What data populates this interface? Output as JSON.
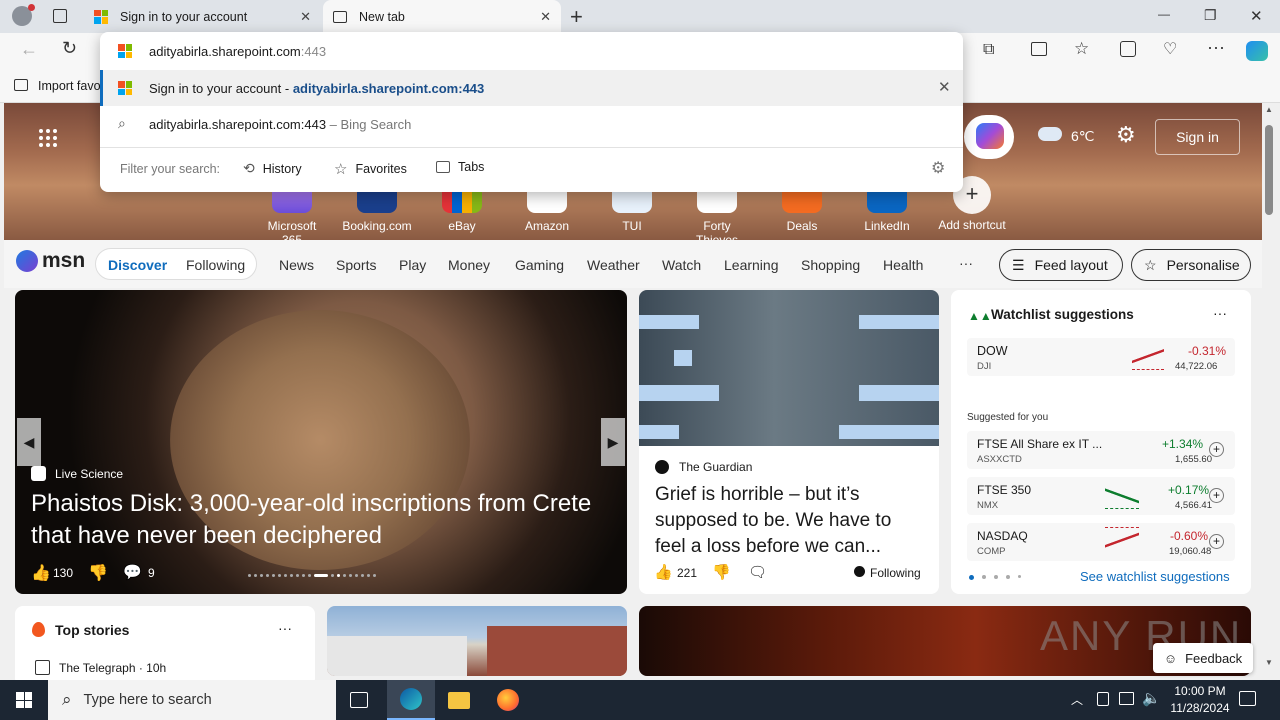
{
  "tabs": [
    {
      "title": "Sign in to your account",
      "active": false
    },
    {
      "title": "New tab",
      "active": true
    }
  ],
  "window_controls": {
    "minimize": "—",
    "restore": "❐",
    "close": "✕"
  },
  "bookmarks": {
    "import": "Import favo"
  },
  "omnibox": {
    "input_value": "adityabirla.sharepoint.com",
    "input_suffix": ":443",
    "suggestions": [
      {
        "title": "Sign in to your account",
        "sep": " - ",
        "url": "adityabirla.sharepoint.com:443"
      },
      {
        "query": "adityabirla.sharepoint.com:443",
        "hint": " – Bing Search"
      }
    ],
    "filter_label": "Filter your search:",
    "filters": [
      "History",
      "Favorites",
      "Tabs"
    ]
  },
  "hero": {
    "weather": "6℃",
    "signin": "Sign in",
    "shortcuts": [
      "Microsoft 365",
      "Booking.com",
      "eBay",
      "Amazon",
      "TUI",
      "Forty Thieves",
      "Deals",
      "LinkedIn",
      "Add shortcut"
    ]
  },
  "msn_nav": {
    "logo": "msn",
    "tabs": [
      "Discover",
      "Following"
    ],
    "links": [
      "News",
      "Sports",
      "Play",
      "Money",
      "Gaming",
      "Weather",
      "Watch",
      "Learning",
      "Shopping",
      "Health"
    ],
    "more": "···",
    "feed_layout": "Feed layout",
    "personalise": "Personalise"
  },
  "main_card": {
    "source": "Live Science",
    "headline": "Phaistos Disk: 3,000-year-old inscriptions from Crete that have never been deciphered",
    "likes": "130",
    "comments": "9"
  },
  "guardian_card": {
    "source": "The Guardian",
    "headline": "Grief is horrible – but it’s supposed to be. We have to feel a loss before we can...",
    "likes": "221",
    "following": "Following"
  },
  "watchlist": {
    "title": "Watchlist suggestions",
    "more": "···",
    "primary": {
      "name": "DOW",
      "sym": "DJI",
      "change": "-0.31%",
      "price": "44,722.06"
    },
    "suggested_label": "Suggested for you",
    "items": [
      {
        "name": "FTSE All Share ex IT ...",
        "sym": "ASXXCTD",
        "change": "+1.34%",
        "price": "1,655.60",
        "up": true
      },
      {
        "name": "FTSE 350",
        "sym": "NMX",
        "change": "+0.17%",
        "price": "4,566.41",
        "up": true
      },
      {
        "name": "NASDAQ",
        "sym": "COMP",
        "change": "-0.60%",
        "price": "19,060.48",
        "up": false
      }
    ],
    "see_more": "See watchlist suggestions"
  },
  "top_stories": {
    "title": "Top stories",
    "more": "···",
    "first_source": "The Telegraph · 10h"
  },
  "feedback": "Feedback",
  "watermark": "ANY RUN",
  "taskbar": {
    "search_placeholder": "Type here to search",
    "time": "10:00 PM",
    "date": "11/28/2024"
  },
  "colors": {
    "accent": "#0f6cbd",
    "up": "#0d7d2e",
    "down": "#c4262e",
    "bing_url": "#1a4e8a"
  }
}
